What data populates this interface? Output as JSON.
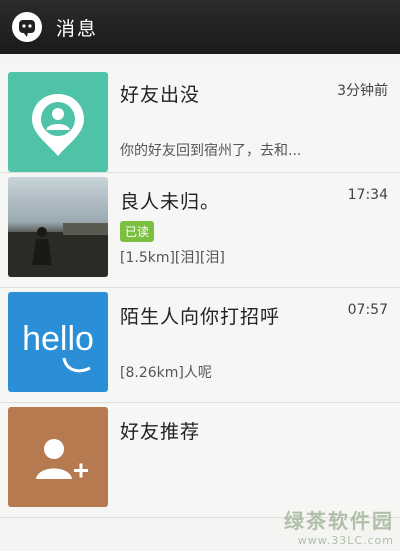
{
  "header": {
    "title": "消息",
    "app_icon": "chat-bubble-icon"
  },
  "messages": [
    {
      "name": "好友出没",
      "time": "3分钟前",
      "preview": "你的好友回到宿州了，去和...",
      "icon": "location-person-icon",
      "color": "#4fc3a8"
    },
    {
      "name": "良人未归。",
      "time": "17:34",
      "badge": "已读",
      "preview": "[1.5km][泪][泪]",
      "icon": "photo-avatar"
    },
    {
      "name": "陌生人向你打招呼",
      "time": "07:57",
      "preview": "[8.26km]人呢",
      "icon_text": "hello",
      "color": "#2a8fd6"
    },
    {
      "name": "好友推荐",
      "icon": "add-person-icon",
      "color": "#b57a4f"
    }
  ],
  "watermark": {
    "text": "绿茶软件园",
    "url": "www.33LC.com"
  }
}
